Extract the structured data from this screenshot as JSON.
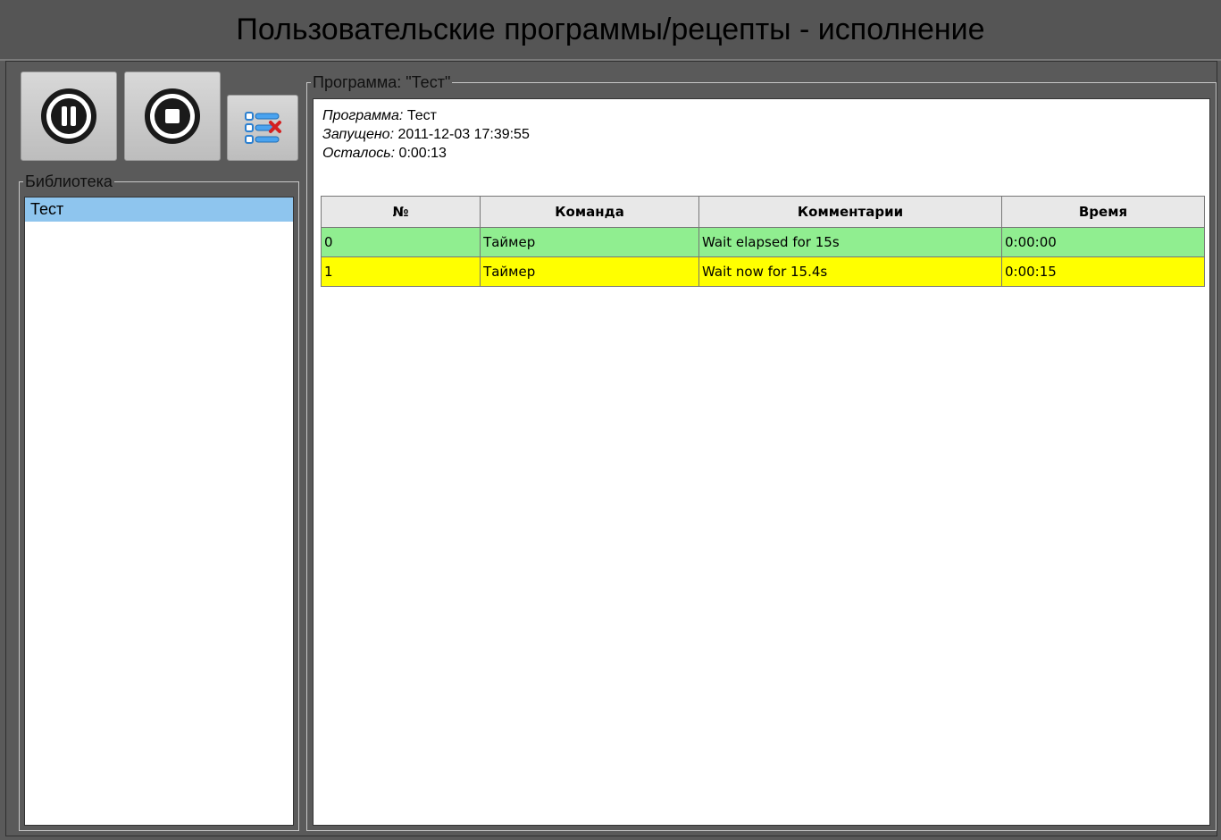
{
  "window": {
    "title": "Пользовательские программы/рецепты - исполнение"
  },
  "toolbar": {
    "pause_icon": "pause-icon",
    "stop_icon": "stop-icon",
    "clear_icon": "list-remove-icon"
  },
  "library": {
    "legend": "Библиотека",
    "items": [
      {
        "label": "Тест",
        "selected": true
      }
    ]
  },
  "program": {
    "legend": "Программа: \"Тест\"",
    "info": {
      "name_label": "Программа:",
      "name_value": "Тест",
      "started_label": "Запущено:",
      "started_value": "2011-12-03 17:39:55",
      "remaining_label": "Осталось:",
      "remaining_value": "0:00:13"
    },
    "table": {
      "headers": [
        "№",
        "Команда",
        "Комментарии",
        "Время"
      ],
      "rows": [
        {
          "n": "0",
          "command": "Таймер",
          "comment": "Wait elapsed for 15s",
          "time": "0:00:00",
          "status": "done"
        },
        {
          "n": "1",
          "command": "Таймер",
          "comment": "Wait now for 15.4s",
          "time": "0:00:15",
          "status": "running"
        }
      ]
    }
  },
  "colors": {
    "done": "#90ee90",
    "running": "#ffff00",
    "selected": "#8ec5ee"
  }
}
